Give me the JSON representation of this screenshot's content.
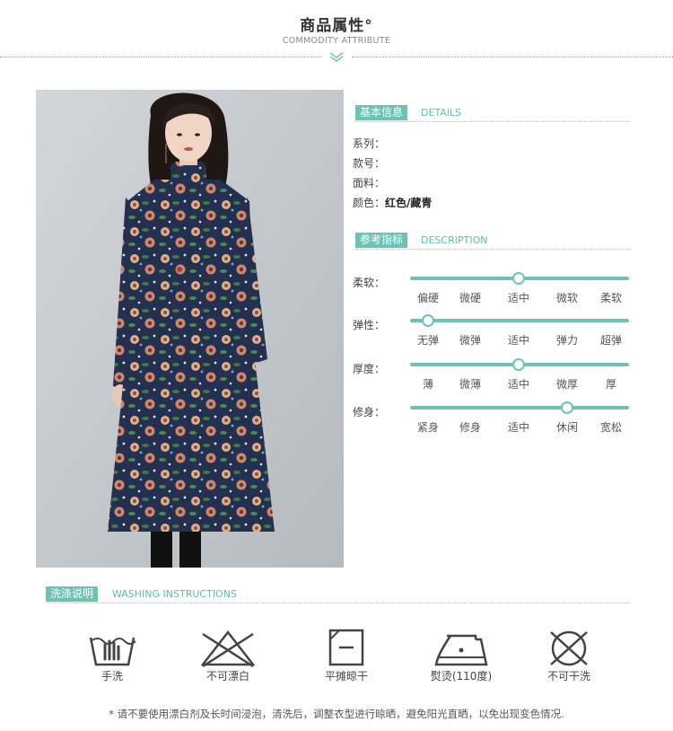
{
  "header": {
    "title": "商品属性°",
    "subtitle": "COMMODITY ATTRIBUTE"
  },
  "details": {
    "tag": "基本信息",
    "tag_en": "DETAILS",
    "rows": [
      {
        "label": "系列：",
        "value": ""
      },
      {
        "label": "款号：",
        "value": ""
      },
      {
        "label": "面料：",
        "value": ""
      },
      {
        "label": "颜色：",
        "value": "红色/藏青"
      }
    ]
  },
  "description": {
    "tag": "参考指标",
    "tag_en": "DESCRIPTION",
    "scales": [
      {
        "label": "柔软：",
        "options": [
          "偏硬",
          "微硬",
          "适中",
          "微软",
          "柔软"
        ],
        "selected_index": 2
      },
      {
        "label": "弹性：",
        "options": [
          "无弹",
          "微弹",
          "适中",
          "弹力",
          "超弹"
        ],
        "selected_index": 0
      },
      {
        "label": "厚度：",
        "options": [
          "薄",
          "微薄",
          "适中",
          "微厚",
          "厚"
        ],
        "selected_index": 2
      },
      {
        "label": "修身：",
        "options": [
          "紧身",
          "修身",
          "适中",
          "休闲",
          "宽松"
        ],
        "selected_index": 3
      }
    ]
  },
  "washing": {
    "tag": "洗涤说明",
    "tag_en": "WASHING INSTRUCTIONS",
    "items": [
      {
        "icon": "hand-wash-icon",
        "label": "手洗"
      },
      {
        "icon": "no-bleach-icon",
        "label": "不可漂白"
      },
      {
        "icon": "dry-flat-shade-icon",
        "label": "平摊晾干"
      },
      {
        "icon": "iron-110-icon",
        "label": "熨烫(110度)"
      },
      {
        "icon": "no-dry-clean-icon",
        "label": "不可干洗"
      }
    ],
    "note": "* 请不要使用漂白剂及长时间浸泡，清洗后，调整衣型进行晾晒，避免阳光直晒，以免出现变色情况."
  },
  "colors": {
    "accent": "#6bc3b4",
    "dress_navy": "#24304f"
  }
}
